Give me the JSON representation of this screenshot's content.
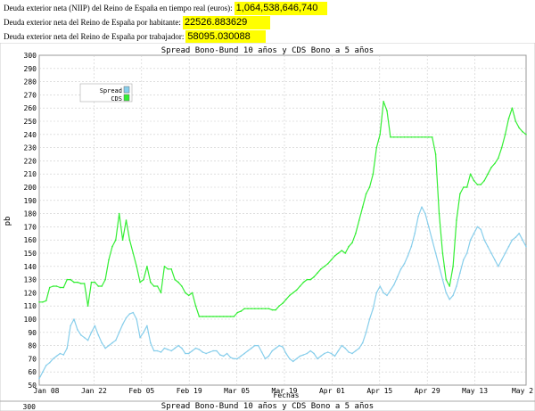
{
  "stats": [
    {
      "label": "Deuda exterior neta (NIIP) del Reino de España en tiempo real (euros):",
      "value": "1,064,538,646,740"
    },
    {
      "label": "Deuda exterior neta del Reino de España por habitante:",
      "value": "22526.883629"
    },
    {
      "label": "Deuda exterior neta del Reino de España por trabajador:",
      "value": "58095.030088"
    }
  ],
  "chart_data": {
    "type": "line",
    "title": "Spread Bono-Bund 10 años y CDS Bono a 5 años",
    "xlabel": "Fechas",
    "ylabel": "pb",
    "ylim": [
      50,
      300
    ],
    "yticks": [
      50,
      60,
      70,
      80,
      90,
      100,
      110,
      120,
      130,
      140,
      150,
      160,
      170,
      180,
      190,
      200,
      210,
      220,
      230,
      240,
      250,
      260,
      270,
      280,
      290,
      300
    ],
    "xticks": [
      "Jan 08",
      "Jan 22",
      "Feb 05",
      "Feb 19",
      "Mar 05",
      "Mar 19",
      "Apr 01",
      "Apr 15",
      "Apr 29",
      "May 13",
      "May 2"
    ],
    "grid": true,
    "legend_position": "top-left",
    "colors": {
      "Spread": "#87ceeb",
      "CDS": "#33ee33"
    },
    "series": [
      {
        "name": "Spread",
        "x": [
          0,
          1,
          2,
          3,
          4,
          5,
          6,
          7,
          8,
          9,
          10,
          11,
          12,
          13,
          14,
          15,
          16,
          17,
          18,
          19,
          20,
          21,
          22,
          23,
          24,
          25,
          26,
          27,
          28,
          29,
          30,
          31,
          32,
          33,
          34,
          35,
          36,
          37,
          38,
          39,
          40,
          41,
          42,
          43,
          44,
          45,
          46,
          47,
          48,
          49,
          50,
          51,
          52,
          53,
          54,
          55,
          56,
          57,
          58,
          59,
          60,
          61,
          62,
          63,
          64,
          65,
          66,
          67,
          68,
          69,
          70,
          71,
          72,
          73,
          74,
          75,
          76,
          77,
          78,
          79,
          80,
          81,
          82,
          83,
          84,
          85,
          86,
          87,
          88,
          89,
          90,
          91,
          92,
          93,
          94,
          95,
          96,
          97,
          98,
          99,
          100,
          101,
          102,
          103,
          104,
          105,
          106,
          107,
          108,
          109,
          110,
          111,
          112,
          113,
          114,
          115,
          116,
          117,
          118,
          119,
          120,
          121,
          122,
          123,
          124,
          125,
          126,
          127,
          128,
          129,
          130,
          131,
          132,
          133,
          134,
          135,
          136,
          137,
          138,
          139,
          140
        ],
        "values": [
          55,
          60,
          65,
          67,
          70,
          72,
          74,
          73,
          78,
          95,
          100,
          92,
          88,
          86,
          84,
          90,
          95,
          88,
          82,
          78,
          80,
          82,
          84,
          90,
          96,
          101,
          104,
          105,
          100,
          86,
          90,
          95,
          82,
          76,
          76,
          75,
          78,
          77,
          76,
          78,
          80,
          78,
          74,
          74,
          76,
          78,
          77,
          75,
          74,
          75,
          76,
          76,
          73,
          72,
          74,
          71,
          70,
          70,
          72,
          74,
          76,
          78,
          80,
          80,
          75,
          70,
          72,
          76,
          78,
          80,
          79,
          74,
          70,
          68,
          70,
          72,
          73,
          74,
          76,
          74,
          70,
          72,
          74,
          75,
          74,
          72,
          76,
          80,
          78,
          75,
          74,
          76,
          78,
          82,
          90,
          100,
          108,
          120,
          125,
          120,
          118,
          122,
          126,
          132,
          138,
          142,
          148,
          155,
          165,
          178,
          185,
          180,
          170,
          160,
          150,
          140,
          130,
          120,
          115,
          118,
          125,
          135,
          145,
          150,
          160,
          165,
          170,
          168,
          160,
          155,
          150,
          145,
          140,
          145,
          150,
          155,
          160,
          162,
          165,
          160,
          155
        ]
      },
      {
        "name": "CDS",
        "x": [
          0,
          1,
          2,
          3,
          4,
          5,
          6,
          7,
          8,
          9,
          10,
          11,
          12,
          13,
          14,
          15,
          16,
          17,
          18,
          19,
          20,
          21,
          22,
          23,
          24,
          25,
          26,
          27,
          28,
          29,
          30,
          31,
          32,
          33,
          34,
          35,
          36,
          37,
          38,
          39,
          40,
          41,
          42,
          43,
          44,
          45,
          46,
          47,
          48,
          49,
          50,
          51,
          52,
          53,
          54,
          55,
          56,
          57,
          58,
          59,
          60,
          61,
          62,
          63,
          64,
          65,
          66,
          67,
          68,
          69,
          70,
          71,
          72,
          73,
          74,
          75,
          76,
          77,
          78,
          79,
          80,
          81,
          82,
          83,
          84,
          85,
          86,
          87,
          88,
          89,
          90,
          91,
          92,
          93,
          94,
          95,
          96,
          97,
          98,
          99,
          100,
          101,
          102,
          103,
          104,
          105,
          106,
          107,
          108,
          109,
          110,
          111,
          112,
          113,
          114,
          115,
          116,
          117,
          118,
          119,
          120,
          121,
          122,
          123,
          124,
          125,
          126,
          127,
          128,
          129,
          130,
          131,
          132,
          133,
          134,
          135,
          136,
          137,
          138,
          139,
          140
        ],
        "values": [
          113,
          113,
          114,
          124,
          125,
          125,
          124,
          124,
          130,
          130,
          128,
          128,
          127,
          127,
          110,
          128,
          128,
          125,
          125,
          130,
          145,
          155,
          160,
          180,
          160,
          175,
          160,
          150,
          140,
          128,
          130,
          140,
          128,
          125,
          125,
          120,
          140,
          138,
          138,
          130,
          128,
          125,
          120,
          118,
          120,
          110,
          102,
          102,
          102,
          102,
          102,
          102,
          102,
          102,
          102,
          102,
          102,
          105,
          106,
          108,
          108,
          108,
          108,
          108,
          108,
          108,
          108,
          107,
          107,
          110,
          112,
          115,
          118,
          120,
          122,
          125,
          128,
          130,
          130,
          132,
          135,
          138,
          140,
          142,
          145,
          148,
          150,
          152,
          150,
          155,
          158,
          165,
          175,
          185,
          195,
          200,
          210,
          230,
          240,
          265,
          258,
          238,
          238,
          238,
          238,
          238,
          238,
          238,
          238,
          238,
          238,
          238,
          238,
          238,
          225,
          180,
          150,
          130,
          125,
          140,
          175,
          195,
          200,
          200,
          210,
          205,
          202,
          202,
          205,
          210,
          215,
          218,
          222,
          230,
          240,
          252,
          260,
          250,
          245,
          242,
          240
        ]
      }
    ]
  },
  "second_chart_title": "Spread Bono-Bund 10 años y CDS Bono a 5 años",
  "second_chart_y_tick": "300"
}
